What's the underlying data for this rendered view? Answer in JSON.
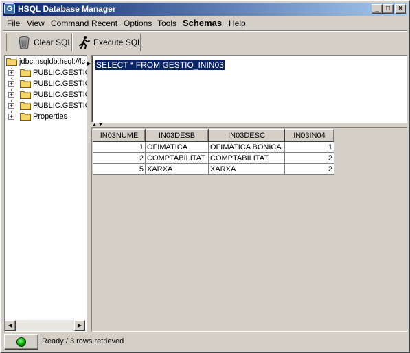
{
  "window": {
    "title": "HSQL Database Manager",
    "icon_letter": "G",
    "controls": [
      "_",
      "□",
      "×"
    ]
  },
  "menu": [
    "File",
    "View",
    "Command",
    "Recent",
    "Options",
    "Tools",
    "Schemas",
    "Help"
  ],
  "toolbar": {
    "clear_sql": "Clear SQL",
    "execute_sql": "Execute SQL"
  },
  "tree": {
    "root": "jdbc:hsqldb:hsql://lc",
    "children": [
      "PUBLIC.GESTIO",
      "PUBLIC.GESTIO",
      "PUBLIC.GESTIO",
      "PUBLIC.GESTIO",
      "Properties"
    ]
  },
  "sql": {
    "text": "SELECT * FROM GESTIO_ININ03"
  },
  "results": {
    "columns": [
      "IN03NUME",
      "IN03DESB",
      "IN03DESC",
      "IN03IN04"
    ],
    "rows": [
      [
        "1",
        "OFIMATICA",
        "OFIMATICA BONICA",
        "1"
      ],
      [
        "2",
        "COMPTABILITAT",
        "COMPTABILITAT",
        "2"
      ],
      [
        "5",
        "XARXA",
        "XARXA",
        "2"
      ]
    ]
  },
  "status": {
    "text": "Ready / 3 rows retrieved",
    "led_color": "#00a000"
  },
  "colors": {
    "title_active": "#0a246a",
    "selection": "#0a246a",
    "face": "#d4d0c8"
  }
}
